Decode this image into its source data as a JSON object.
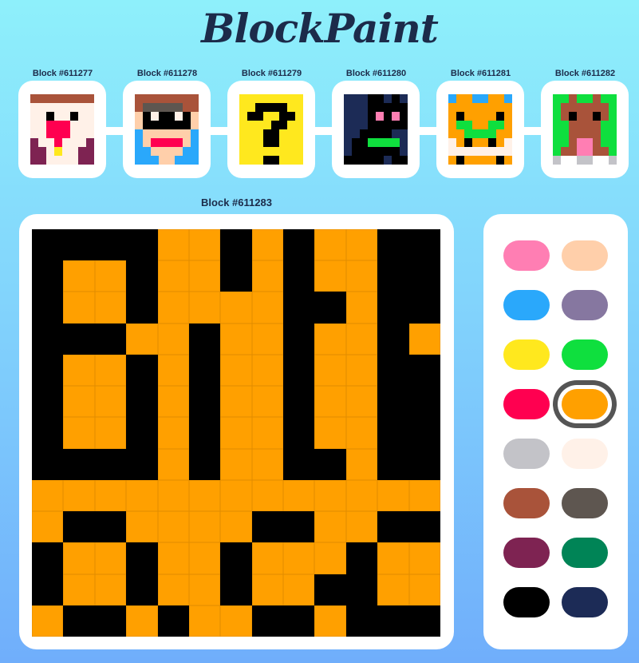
{
  "app": {
    "title": "BlockPaint"
  },
  "blocks": [
    {
      "label": "Block #611277"
    },
    {
      "label": "Block #611278"
    },
    {
      "label": "Block #611279"
    },
    {
      "label": "Block #611280"
    },
    {
      "label": "Block #611281"
    },
    {
      "label": "Block #611282"
    }
  ],
  "current_block": {
    "label": "Block #611283",
    "grid_size": 13,
    "pixels": [
      "KKKKOOKOKOOKK",
      "KOOKOOKOKOOKK",
      "KOOKOOOOKKOKK",
      "KKKOOKOOKOOKO",
      "KOOKOKOOKOOKK",
      "KOOKOKOOKOOKK",
      "KOOKOKOOKOOKK",
      "KKKKOKOOKKOKK",
      "OOOOOOOOOOOOO",
      "OKKOOOOKKOOKK",
      "KOOKOOKOOOKOO",
      "KOOKOOKOOKKOO",
      "OKKOKOOKKOKKK"
    ],
    "pixel_colors": {
      "K": "#000000",
      "O": "#ffa000"
    }
  },
  "palette": {
    "selected": "orange",
    "swatches": [
      {
        "name": "pink",
        "color": "#ff7eb3"
      },
      {
        "name": "peach",
        "color": "#ffcfaa"
      },
      {
        "name": "sky-blue",
        "color": "#2aa8fb"
      },
      {
        "name": "lavender",
        "color": "#8677a0"
      },
      {
        "name": "yellow",
        "color": "#ffe81e"
      },
      {
        "name": "green",
        "color": "#0fdf3e"
      },
      {
        "name": "red",
        "color": "#ff0050"
      },
      {
        "name": "orange",
        "color": "#ffa000"
      },
      {
        "name": "light-gray",
        "color": "#c3c3c8"
      },
      {
        "name": "cream",
        "color": "#fff1e8"
      },
      {
        "name": "brown",
        "color": "#a9533a"
      },
      {
        "name": "dark-gray",
        "color": "#5e5650"
      },
      {
        "name": "plum",
        "color": "#7e2352"
      },
      {
        "name": "dark-green",
        "color": "#008456"
      },
      {
        "name": "black",
        "color": "#000000"
      },
      {
        "name": "navy",
        "color": "#1c2b56"
      }
    ]
  }
}
